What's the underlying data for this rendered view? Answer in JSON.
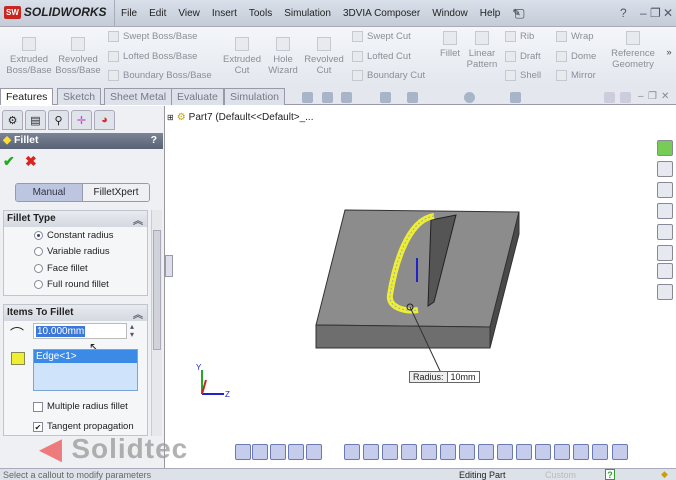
{
  "app": {
    "name": "SOLIDWORKS",
    "logo_mark": "SW"
  },
  "menu": [
    "File",
    "Edit",
    "View",
    "Insert",
    "Tools",
    "Simulation",
    "3DVIA Composer",
    "Window",
    "Help"
  ],
  "commands": {
    "extruded_boss": "Extruded Boss/Base",
    "revolved_boss": "Revolved Boss/Base",
    "swept_boss": "Swept Boss/Base",
    "lofted_boss": "Lofted Boss/Base",
    "boundary_boss": "Boundary Boss/Base",
    "extruded_cut": "Extruded Cut",
    "hole_wizard": "Hole Wizard",
    "revolved_cut": "Revolved Cut",
    "swept_cut": "Swept Cut",
    "lofted_cut": "Lofted Cut",
    "boundary_cut": "Boundary Cut",
    "fillet": "Fillet",
    "linear_pattern": "Linear Pattern",
    "rib": "Rib",
    "draft": "Draft",
    "shell": "Shell",
    "wrap": "Wrap",
    "dome": "Dome",
    "mirror": "Mirror",
    "reference_geometry": "Reference Geometry",
    "more": "»"
  },
  "tabs": [
    "Features",
    "Sketch",
    "Sheet Metal",
    "Evaluate",
    "Simulation"
  ],
  "tree": {
    "item": "Part7  (Default<<Default>_..."
  },
  "property_manager": {
    "title": "Fillet",
    "help": "?",
    "modes": [
      "Manual",
      "FilletXpert"
    ],
    "fillet_type": {
      "title": "Fillet Type",
      "options": [
        "Constant radius",
        "Variable radius",
        "Face fillet",
        "Full round fillet"
      ],
      "selected": 0
    },
    "items": {
      "title": "Items To Fillet",
      "radius_value": "10.000mm",
      "selection": "Edge<1>"
    },
    "multiple_radius": {
      "label": "Multiple radius fillet",
      "checked": false
    },
    "tangent": {
      "label": "Tangent propagation",
      "checked": true
    }
  },
  "viewport": {
    "callout_label": "Radius:",
    "callout_value": "10mm",
    "axis_y": "Y",
    "axis_z": "Z"
  },
  "watermark": "Solidtec",
  "status": {
    "left": "Select a callout to modify parameters",
    "mode": "Editing Part",
    "units": "Custom",
    "help": "?"
  }
}
